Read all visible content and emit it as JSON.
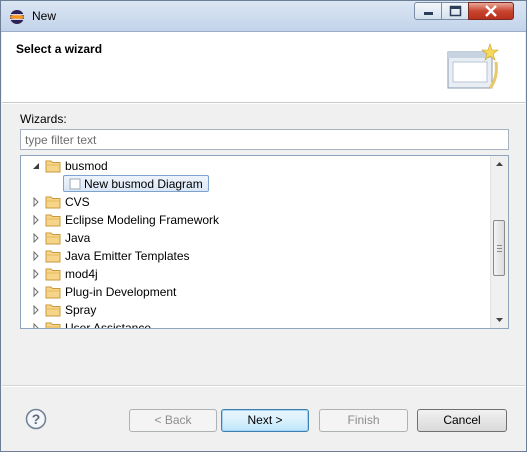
{
  "window": {
    "title": "New"
  },
  "banner": {
    "title": "Select a wizard"
  },
  "wizards": {
    "label": "Wizards:",
    "filter_placeholder": "type filter text"
  },
  "tree": {
    "items": [
      {
        "label": "busmod",
        "expanded": true
      },
      {
        "label": "CVS",
        "expanded": false
      },
      {
        "label": "Eclipse Modeling Framework",
        "expanded": false
      },
      {
        "label": "Java",
        "expanded": false
      },
      {
        "label": "Java Emitter Templates",
        "expanded": false
      },
      {
        "label": "mod4j",
        "expanded": false
      },
      {
        "label": "Plug-in Development",
        "expanded": false
      },
      {
        "label": "Spray",
        "expanded": false
      },
      {
        "label": "User Assistance",
        "expanded": false
      }
    ],
    "selected_child": "New busmod Diagram"
  },
  "buttons": {
    "back": "< Back",
    "next": "Next >",
    "finish": "Finish",
    "cancel": "Cancel"
  },
  "icons": {
    "app": "eclipse-icon",
    "help": "help-icon",
    "folder": "folder-icon",
    "wizard_banner": "wizard-banner-icon"
  },
  "colors": {
    "selection": "#dbe7f6",
    "close_button": "#c8452f"
  }
}
